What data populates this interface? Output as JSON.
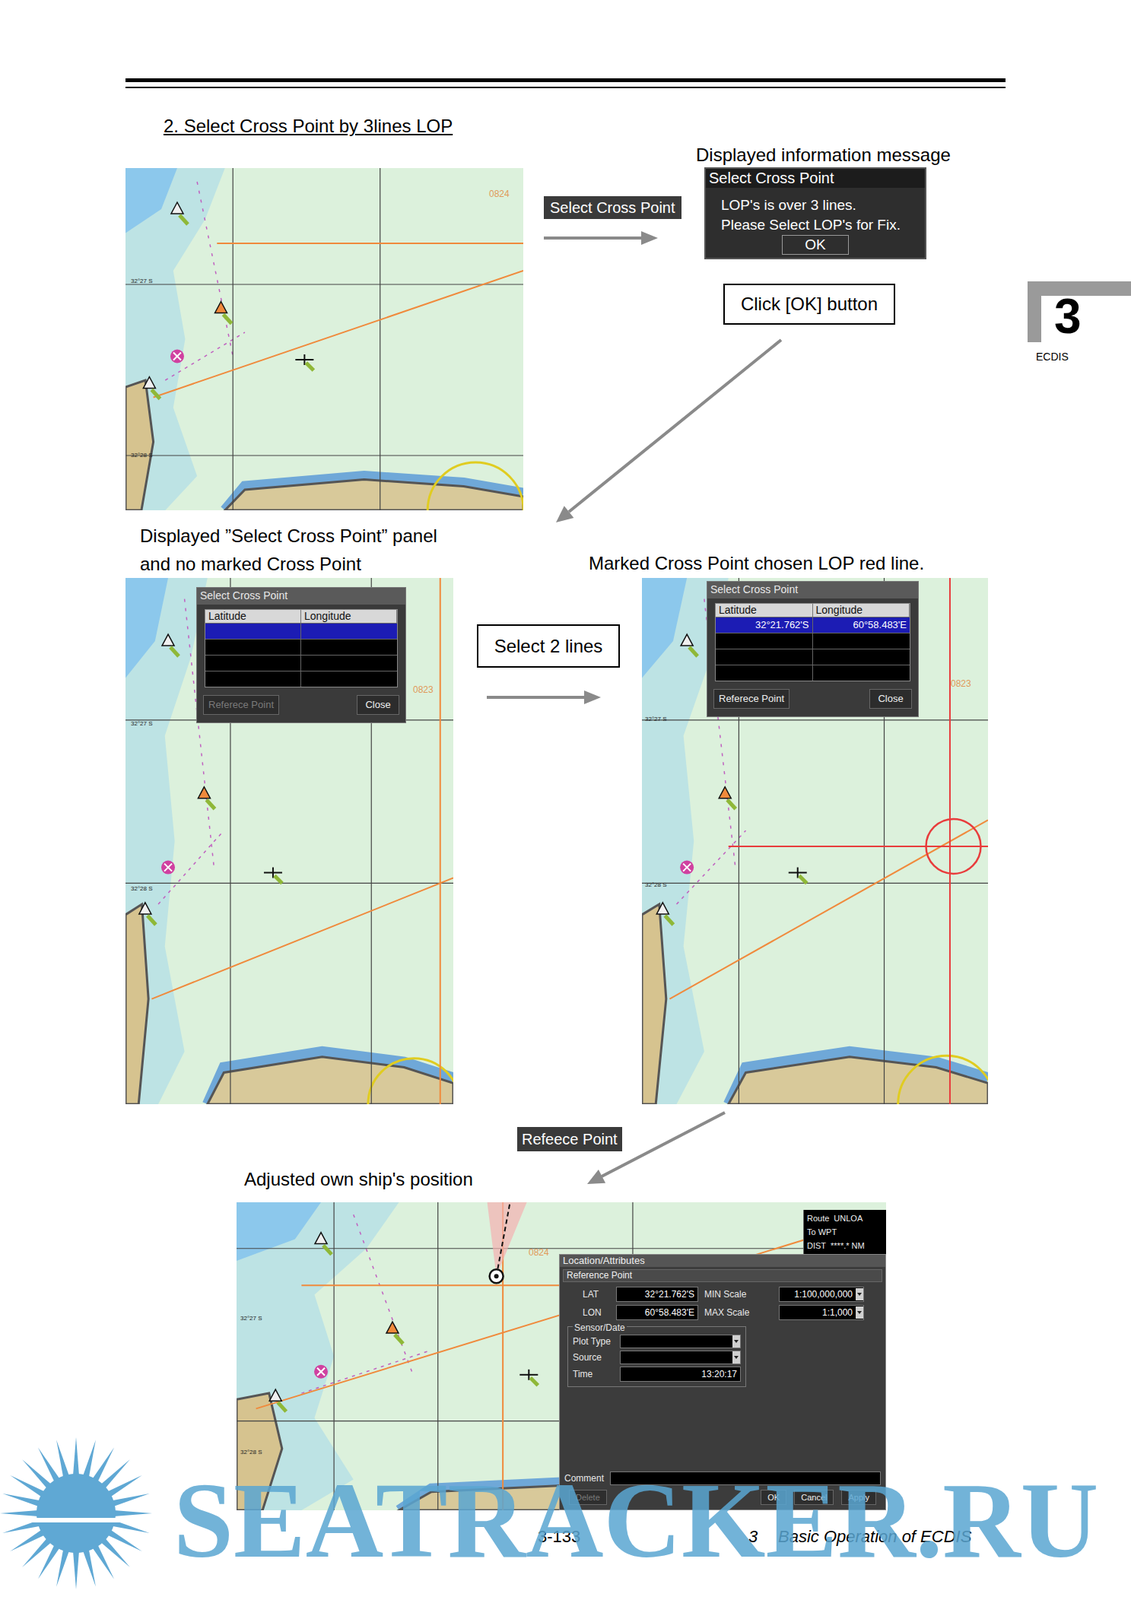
{
  "page": {
    "heading": "2. Select Cross Point by 3lines LOP",
    "page_number": "3-133",
    "chapter_number": "3",
    "chapter_title": "Basic Operation of ECDIS"
  },
  "side_tab": {
    "number": "3",
    "label": "ECDIS"
  },
  "callouts": {
    "select_cross_point_button": "Select Cross Point",
    "info_caption": "Displayed information message",
    "click_ok": "Click [OK] button",
    "panel_caption": [
      "Displayed ”Select Cross Point” panel",
      "and no marked Cross Point"
    ],
    "marked_caption": "Marked Cross Point chosen LOP red line.",
    "select_lines": "Select 2 lines",
    "reference_point_button": "Refeece Point",
    "adjusted_caption": "Adjusted own ship's position"
  },
  "info_dialog": {
    "title": "Select Cross Point",
    "lines": [
      "LOP's is over 3 lines.",
      "Please Select LOP's for Fix."
    ],
    "button": "OK"
  },
  "charts": [
    {
      "labels": [
        "0824",
        "32°27 S",
        "32°28 S"
      ],
      "cross_marked": false,
      "ship_shown": false
    },
    {
      "labels": [
        "0823",
        "32°27 S",
        "32°28 S"
      ],
      "cross_marked": false,
      "ship_shown": false
    },
    {
      "labels": [
        "0823",
        "32°27 S",
        "32°28 S"
      ],
      "cross_marked": true,
      "ship_shown": false
    },
    {
      "labels": [
        "0824",
        "32°27 S",
        "32°28 S"
      ],
      "cross_marked": false,
      "ship_shown": true
    }
  ],
  "cross_point_panels": [
    {
      "title": "Select Cross Point",
      "columns": [
        "Latitude",
        "Longitude"
      ],
      "rows": [
        {
          "latitude": "",
          "longitude": "",
          "selected": true
        },
        {
          "latitude": "",
          "longitude": "",
          "selected": false
        },
        {
          "latitude": "",
          "longitude": "",
          "selected": false
        },
        {
          "latitude": "",
          "longitude": "",
          "selected": false
        }
      ],
      "buttons": [
        {
          "label": "Referece Point",
          "disabled": true
        },
        {
          "label": "Close",
          "disabled": false
        }
      ]
    },
    {
      "title": "Select Cross Point",
      "columns": [
        "Latitude",
        "Longitude"
      ],
      "rows": [
        {
          "latitude": "32°21.762'S",
          "longitude": "60°58.483'E",
          "selected": true
        },
        {
          "latitude": "",
          "longitude": "",
          "selected": false
        },
        {
          "latitude": "",
          "longitude": "",
          "selected": false
        },
        {
          "latitude": "",
          "longitude": "",
          "selected": false
        }
      ],
      "buttons": [
        {
          "label": "Referece Point",
          "disabled": false
        },
        {
          "label": "Close",
          "disabled": false
        }
      ]
    }
  ],
  "location_panel": {
    "title": "Location/Attributes",
    "section": "Reference Point",
    "lat_label": "LAT",
    "lat": "32°21.762'S",
    "lon_label": "LON",
    "lon": "60°58.483'E",
    "min_scale_label": "MIN Scale",
    "min_scale": "1:100,000,000",
    "max_scale_label": "MAX Scale",
    "max_scale": "1:1,000",
    "group": "Sensor/Date",
    "plot_type_label": "Plot Type",
    "plot_type": "",
    "source_label": "Source",
    "source": "",
    "time_label": "Time",
    "time": "13:20:17",
    "comment_label": "Comment",
    "comment": "",
    "buttons": [
      {
        "label": "Delete",
        "disabled": true
      },
      {
        "label": "OK",
        "disabled": false
      },
      {
        "label": "Cancel",
        "disabled": false
      },
      {
        "label": "Apply",
        "disabled": false
      }
    ]
  },
  "route_panel": {
    "rows": [
      {
        "label": "Route",
        "value": "UNLOA"
      },
      {
        "label": "To WPT",
        "value": ""
      },
      {
        "label": "DIST",
        "value": "****.* NM"
      }
    ]
  },
  "watermark": "SEATRACKER.RU"
}
